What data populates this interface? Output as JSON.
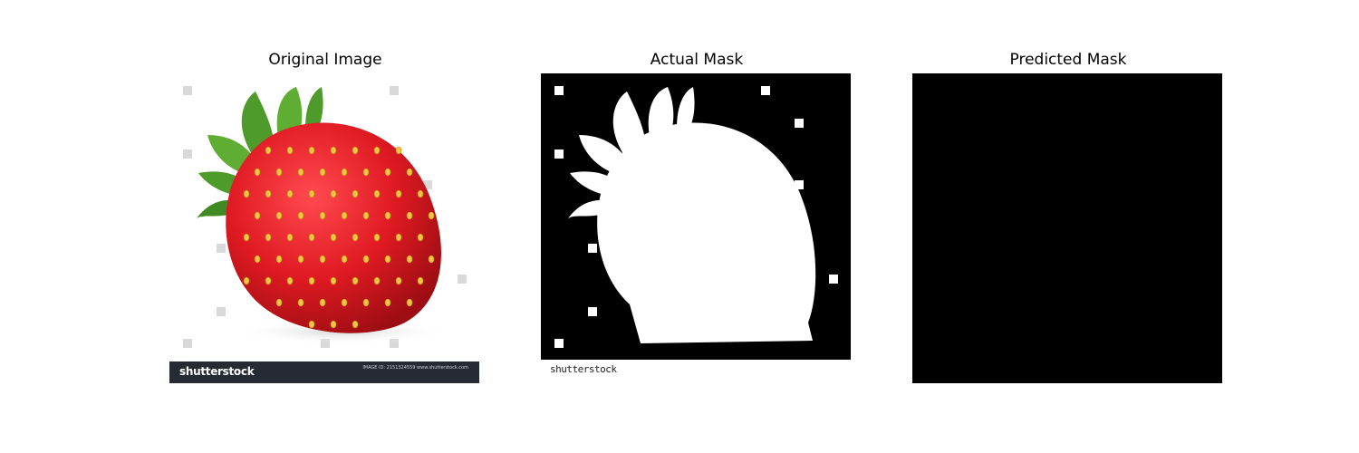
{
  "panels": [
    {
      "title": "Original Image"
    },
    {
      "title": "Actual Mask"
    },
    {
      "title": "Predicted Mask"
    }
  ],
  "original": {
    "banner_logo": "shutterstock",
    "banner_meta": "IMAGE ID: 2151324559 www.shutterstock.com",
    "banner_color": "#262b33",
    "fruit_color": "#e01a22",
    "leaf_color": "#4e9a2a"
  },
  "mask": {
    "strip_text": "shutterstock"
  }
}
